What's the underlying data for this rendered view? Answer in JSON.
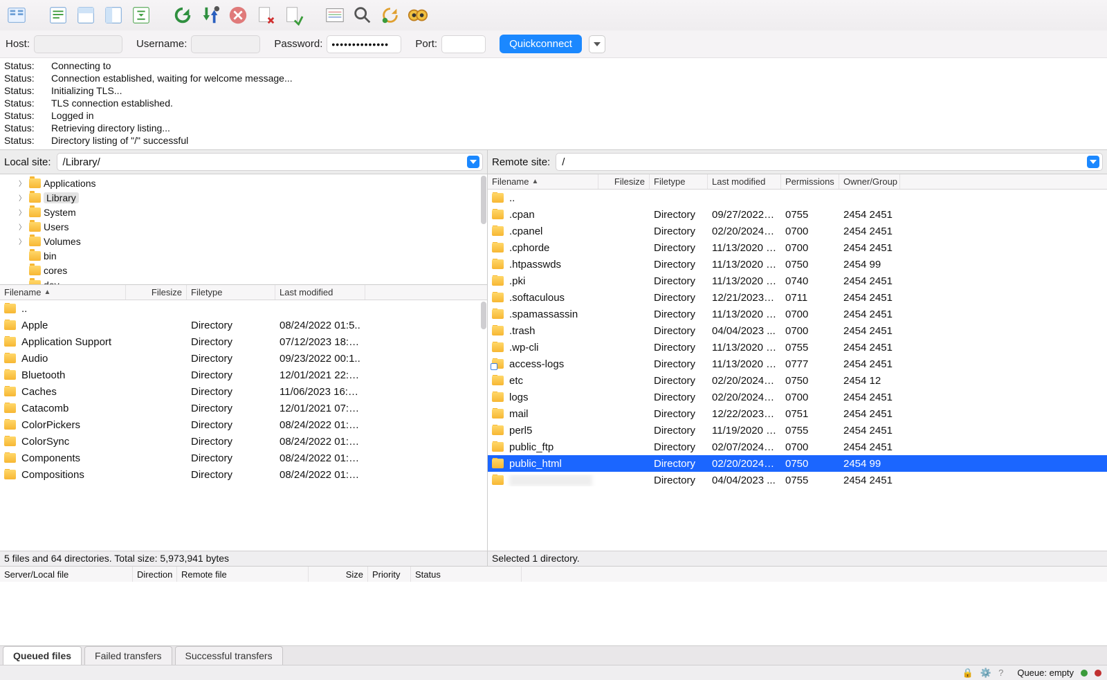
{
  "conn": {
    "host_label": "Host:",
    "user_label": "Username:",
    "pass_label": "Password:",
    "port_label": "Port:",
    "pass_value": "●●●●●●●●●●●●●●",
    "quickconnect": "Quickconnect"
  },
  "log": [
    {
      "label": "Status:",
      "msg": "Connecting to"
    },
    {
      "label": "Status:",
      "msg": "Connection established, waiting for welcome message..."
    },
    {
      "label": "Status:",
      "msg": "Initializing TLS..."
    },
    {
      "label": "Status:",
      "msg": "TLS connection established."
    },
    {
      "label": "Status:",
      "msg": "Logged in"
    },
    {
      "label": "Status:",
      "msg": "Retrieving directory listing..."
    },
    {
      "label": "Status:",
      "msg": "Directory listing of \"/\" successful"
    }
  ],
  "local": {
    "label": "Local site:",
    "path": "/Library/",
    "tree": [
      {
        "name": "Applications",
        "expandable": true,
        "indent": 1
      },
      {
        "name": "Library",
        "expandable": true,
        "indent": 1,
        "selected": true
      },
      {
        "name": "System",
        "expandable": true,
        "indent": 1
      },
      {
        "name": "Users",
        "expandable": true,
        "indent": 1
      },
      {
        "name": "Volumes",
        "expandable": true,
        "indent": 1
      },
      {
        "name": "bin",
        "expandable": false,
        "indent": 1
      },
      {
        "name": "cores",
        "expandable": false,
        "indent": 1
      },
      {
        "name": "dev",
        "expandable": false,
        "indent": 1
      }
    ],
    "columns": {
      "filename": "Filename",
      "filesize": "Filesize",
      "filetype": "Filetype",
      "modified": "Last modified"
    },
    "col_widths": {
      "filename": 182,
      "filesize": 88,
      "filetype": 128,
      "modified": 130
    },
    "files": [
      {
        "name": "..",
        "type": "",
        "mod": ""
      },
      {
        "name": "Apple",
        "type": "Directory",
        "mod": "08/24/2022 01:5.."
      },
      {
        "name": "Application Support",
        "type": "Directory",
        "mod": "07/12/2023 18:2..."
      },
      {
        "name": "Audio",
        "type": "Directory",
        "mod": "09/23/2022 00:1.."
      },
      {
        "name": "Bluetooth",
        "type": "Directory",
        "mod": "12/01/2021 22:4..."
      },
      {
        "name": "Caches",
        "type": "Directory",
        "mod": "11/06/2023 16:4..."
      },
      {
        "name": "Catacomb",
        "type": "Directory",
        "mod": "12/01/2021 07:5..."
      },
      {
        "name": "ColorPickers",
        "type": "Directory",
        "mod": "08/24/2022 01:5..."
      },
      {
        "name": "ColorSync",
        "type": "Directory",
        "mod": "08/24/2022 01:5..."
      },
      {
        "name": "Components",
        "type": "Directory",
        "mod": "08/24/2022 01:5..."
      },
      {
        "name": "Compositions",
        "type": "Directory",
        "mod": "08/24/2022 01:5..."
      }
    ],
    "status": "5 files and 64 directories. Total size: 5,973,941 bytes"
  },
  "remote": {
    "label": "Remote site:",
    "path": "/",
    "columns": {
      "filename": "Filename",
      "filesize": "Filesize",
      "filetype": "Filetype",
      "modified": "Last modified",
      "perms": "Permissions",
      "owner": "Owner/Group"
    },
    "col_widths": {
      "filename": 160,
      "filesize": 74,
      "filetype": 84,
      "modified": 106,
      "perms": 84,
      "owner": 88
    },
    "files": [
      {
        "name": "..",
        "type": "",
        "mod": "",
        "perm": "",
        "owner": ""
      },
      {
        "name": ".cpan",
        "type": "Directory",
        "mod": "09/27/2022 1...",
        "perm": "0755",
        "owner": "2454 2451"
      },
      {
        "name": ".cpanel",
        "type": "Directory",
        "mod": "02/20/2024 1..",
        "perm": "0700",
        "owner": "2454 2451"
      },
      {
        "name": ".cphorde",
        "type": "Directory",
        "mod": "11/13/2020 0...",
        "perm": "0700",
        "owner": "2454 2451"
      },
      {
        "name": ".htpasswds",
        "type": "Directory",
        "mod": "11/13/2020 0...",
        "perm": "0750",
        "owner": "2454 99"
      },
      {
        "name": ".pki",
        "type": "Directory",
        "mod": "11/13/2020 0...",
        "perm": "0740",
        "owner": "2454 2451"
      },
      {
        "name": ".softaculous",
        "type": "Directory",
        "mod": "12/21/2023 1...",
        "perm": "0711",
        "owner": "2454 2451"
      },
      {
        "name": ".spamassassin",
        "type": "Directory",
        "mod": "11/13/2020 0...",
        "perm": "0700",
        "owner": "2454 2451"
      },
      {
        "name": ".trash",
        "type": "Directory",
        "mod": "04/04/2023 ...",
        "perm": "0700",
        "owner": "2454 2451"
      },
      {
        "name": ".wp-cli",
        "type": "Directory",
        "mod": "11/13/2020 0...",
        "perm": "0755",
        "owner": "2454 2451"
      },
      {
        "name": "access-logs",
        "type": "Directory",
        "mod": "11/13/2020 0...",
        "perm": "0777",
        "owner": "2454 2451",
        "link": true
      },
      {
        "name": "etc",
        "type": "Directory",
        "mod": "02/20/2024 1...",
        "perm": "0750",
        "owner": "2454 12"
      },
      {
        "name": "logs",
        "type": "Directory",
        "mod": "02/20/2024 1...",
        "perm": "0700",
        "owner": "2454 2451"
      },
      {
        "name": "mail",
        "type": "Directory",
        "mod": "12/22/2023 1...",
        "perm": "0751",
        "owner": "2454 2451"
      },
      {
        "name": "perl5",
        "type": "Directory",
        "mod": "11/19/2020 1...",
        "perm": "0755",
        "owner": "2454 2451"
      },
      {
        "name": "public_ftp",
        "type": "Directory",
        "mod": "02/07/2024 1...",
        "perm": "0700",
        "owner": "2454 2451"
      },
      {
        "name": "public_html",
        "type": "Directory",
        "mod": "02/20/2024 1..",
        "perm": "0750",
        "owner": "2454 99",
        "selected": true
      },
      {
        "name": "████████",
        "type": "Directory",
        "mod": "04/04/2023 ...",
        "perm": "0755",
        "owner": "2454 2451",
        "blurred": true
      }
    ],
    "status": "Selected 1 directory."
  },
  "queue": {
    "columns": {
      "server": "Server/Local file",
      "direction": "Direction",
      "remote": "Remote file",
      "size": "Size",
      "priority": "Priority",
      "status": "Status"
    }
  },
  "tabs": {
    "queued": "Queued files",
    "failed": "Failed transfers",
    "success": "Successful transfers"
  },
  "bottom": {
    "queue": "Queue: empty"
  }
}
